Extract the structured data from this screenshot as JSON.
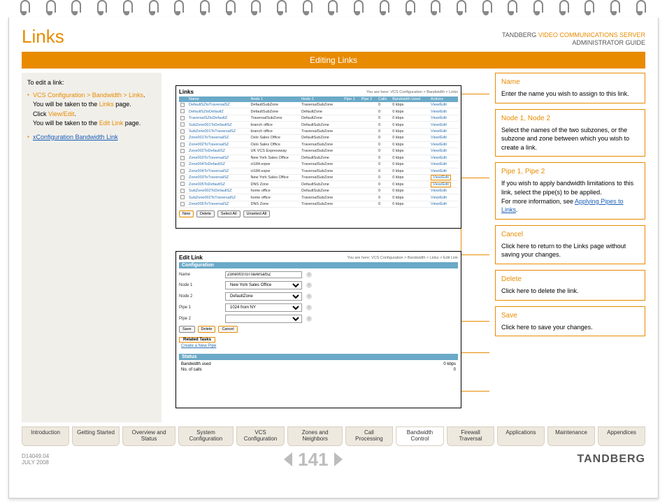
{
  "header": {
    "title": "Links",
    "company": "TANDBERG",
    "product": "VIDEO COMMUNICATIONS SERVER",
    "guide": "ADMINISTRATOR GUIDE",
    "section": "Editing Links"
  },
  "sidebar": {
    "lead": "To edit a link:",
    "nav_path": "VCS Configuration > Bandwidth > Links",
    "line1a": "You will be taken to the ",
    "line1b_link": "Links",
    "line1c": " page.",
    "line2a": "Click ",
    "line2b_link": "View/Edit",
    "line2c": ".",
    "line3a": "You will be taken to the ",
    "line3b_link": "Edit Link",
    "line3c": " page.",
    "xconfig": "xConfiguration Bandwidth Link"
  },
  "links_panel": {
    "title": "Links",
    "breadcrumb": "You are here: VCS Configuration > Bandwidth > Links",
    "cols": [
      "Name",
      "Node 1",
      "Node 2",
      "Pipe 1",
      "Pipe 2",
      "Calls",
      "Bandwidth Used",
      "Actions"
    ],
    "rows": [
      {
        "name": "DefaultSZtoTraversalSZ",
        "n1": "DefaultSubZone",
        "n2": "TraversalSubZone",
        "c": "0",
        "b": "0 kbps",
        "a": "View/Edit"
      },
      {
        "name": "DefaultSZtoDefaultZ",
        "n1": "DefaultSubZone",
        "n2": "DefaultZone",
        "c": "0",
        "b": "0 kbps",
        "a": "View/Edit"
      },
      {
        "name": "TraversalSZtoDefaultZ",
        "n1": "TraversalSubZone",
        "n2": "DefaultZone",
        "c": "0",
        "b": "0 kbps",
        "a": "View/Edit"
      },
      {
        "name": "SubZone001ToDefaultSZ",
        "n1": "branch office",
        "n2": "DefaultSubZone",
        "c": "0",
        "b": "0 kbps",
        "a": "View/Edit"
      },
      {
        "name": "SubZone001ToTraversalSZ",
        "n1": "branch office",
        "n2": "TraversalSubZone",
        "c": "0",
        "b": "0 kbps",
        "a": "View/Edit"
      },
      {
        "name": "Zone001ToTraversalSZ",
        "n1": "Oslo Sales Office",
        "n2": "DefaultSubZone",
        "c": "0",
        "b": "0 kbps",
        "a": "View/Edit"
      },
      {
        "name": "Zone002ToTraversalSZ",
        "n1": "Oslo Sales Office",
        "n2": "TraversalSubZone",
        "c": "0",
        "b": "0 kbps",
        "a": "View/Edit"
      },
      {
        "name": "Zone002ToDefaultSZ",
        "n1": "UK VCS Expressway",
        "n2": "TraversalSubZone",
        "c": "0",
        "b": "0 kbps",
        "a": "View/Edit"
      },
      {
        "name": "Zone003ToTraversalSZ",
        "n1": "New York Sales Office",
        "n2": "DefaultSubZone",
        "c": "0",
        "b": "0 kbps",
        "a": "View/Edit"
      },
      {
        "name": "Zone004ToDefaultSZ",
        "n1": "ct184.expw",
        "n2": "TraversalSubZone",
        "c": "0",
        "b": "0 kbps",
        "a": "View/Edit"
      },
      {
        "name": "Zone004ToTraversalSZ",
        "n1": "ct184.expw",
        "n2": "TraversalSubZone",
        "c": "0",
        "b": "0 kbps",
        "a": "View/Edit"
      },
      {
        "name": "Zone003ToTraversalSZ",
        "n1": "New York Sales Office",
        "n2": "TraversalSubZone",
        "c": "0",
        "b": "0 kbps",
        "a": "View/Edit",
        "hl": true
      },
      {
        "name": "Zone005ToDefaultSZ",
        "n1": "DNS Zone",
        "n2": "DefaultSubZone",
        "c": "0",
        "b": "0 kbps",
        "a": "View/Edit",
        "hl": true
      },
      {
        "name": "SubZone002ToDefaultSZ",
        "n1": "home office",
        "n2": "DefaultSubZone",
        "c": "0",
        "b": "0 kbps",
        "a": "View/Edit"
      },
      {
        "name": "SubZone002ToTraversalSZ",
        "n1": "home office",
        "n2": "TraversalSubZone",
        "c": "0",
        "b": "0 kbps",
        "a": "View/Edit"
      },
      {
        "name": "Zone005ToTraversalSZ",
        "n1": "DNS Zone",
        "n2": "TraversalSubZone",
        "c": "0",
        "b": "0 kbps",
        "a": "View/Edit"
      }
    ],
    "btn_new": "New",
    "btn_delete": "Delete",
    "btn_selectall": "Select All",
    "btn_unselectall": "Unselect All"
  },
  "edit_panel": {
    "title": "Edit Link",
    "breadcrumb": "You are here: VCS Configuration > Bandwidth > Links > Edit Link",
    "section_config": "Configuration",
    "l_name": "Name",
    "v_name": "Zone003ToTraversalSZ",
    "l_node1": "Node 1",
    "v_node1": "New York Sales Office",
    "l_node2": "Node 2",
    "v_node2": "DefaultZone",
    "l_pipe1": "Pipe 1",
    "v_pipe1": "1024 from NY",
    "l_pipe2": "Pipe 2",
    "v_pipe2": "",
    "btn_save": "Save",
    "btn_delete": "Delete",
    "btn_cancel": "Cancel",
    "section_related": "Related Tasks",
    "related_link": "Create a New Pipe",
    "section_status": "Status",
    "s1l": "Bandwidth used",
    "s1v": "0 kbps",
    "s2l": "No. of calls",
    "s2v": "0"
  },
  "callouts": {
    "name": {
      "title": "Name",
      "body": "Enter the name you wish to assign to this link."
    },
    "nodes": {
      "title": "Node 1, Node 2",
      "body": "Select the names of the two subzones, or the subzone and zone between which you wish to create a link."
    },
    "pipes": {
      "title": "Pipe 1, Pipe 2",
      "body": "If you wish to apply bandwidth limitations to this link, select the pipe(s) to be applied.",
      "more": "For more information, see ",
      "link": "Applying Pipes to Links",
      "tail": "."
    },
    "cancel": {
      "title": "Cancel",
      "body": "Click here to return to the Links page without saving your changes."
    },
    "delete": {
      "title": "Delete",
      "body": "Click here to delete the link."
    },
    "save": {
      "title": "Save",
      "body": "Click here to save your changes."
    }
  },
  "tabs": [
    "Introduction",
    "Getting Started",
    "Overview and Status",
    "System Configuration",
    "VCS Configuration",
    "Zones and Neighbors",
    "Call Processing",
    "Bandwidth Control",
    "Firewall Traversal",
    "Applications",
    "Maintenance",
    "Appendices"
  ],
  "active_tab": 7,
  "footer": {
    "docid": "D14049.04",
    "date": "JULY 2008",
    "page": "141",
    "brand": "TANDBERG"
  }
}
